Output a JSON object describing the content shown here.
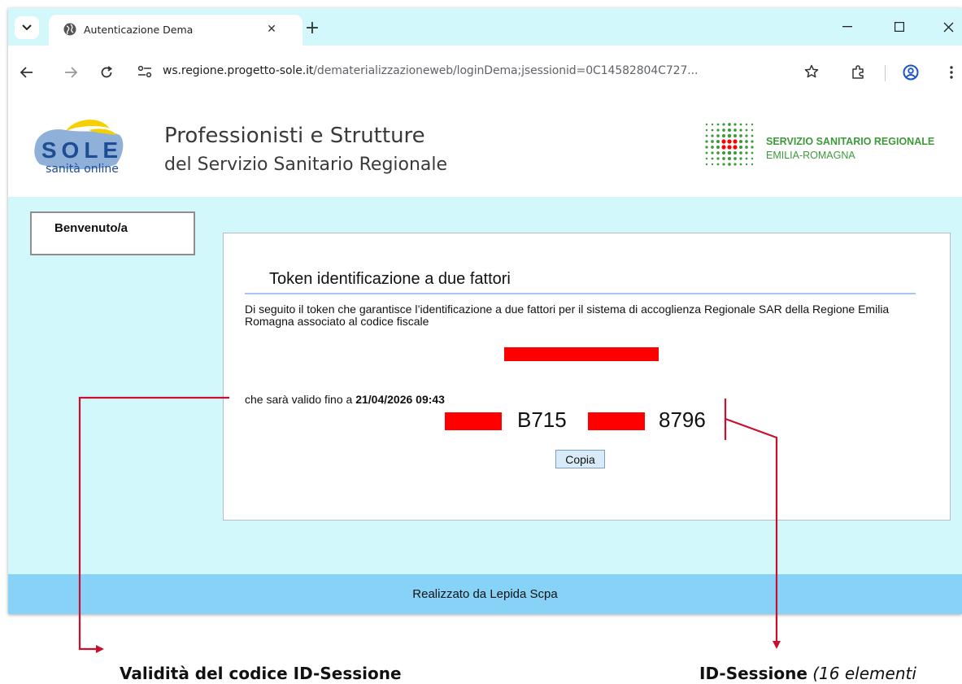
{
  "browser": {
    "tab": {
      "title": "Autenticazione Dema",
      "close_glyph": "✕",
      "favicon": "globe-icon"
    },
    "new_tab_glyph": "+",
    "window_controls": [
      "minimize-icon",
      "maximize-icon",
      "close-icon"
    ],
    "address_bar": {
      "host": "ws.regione.progetto-sole.it",
      "path": "/dematerializzazioneweb/loginDema;jsessionid=0C14582804C727..."
    },
    "toolbar_icons": [
      "back-icon",
      "forward-icon",
      "reload-icon",
      "site-info-icon",
      "star-icon",
      "extensions-icon",
      "profile-icon",
      "menu-icon"
    ]
  },
  "page": {
    "header": {
      "logo_word": "SOLE",
      "logo_tagline": "sanità online",
      "title": "Professionisti e Strutture",
      "subtitle": "del Servizio Sanitario Regionale",
      "ssr_line1": "SERVIZIO SANITARIO REGIONALE",
      "ssr_line2": "EMILIA-ROMAGNA"
    },
    "welcome": "Benvenuto/a",
    "panel": {
      "title": "Token identificazione a due fattori",
      "description": "Di seguito il token che garantisce l’identificazione a due fattori per il sistema di accoglienza Regionale SAR della Regione Emilia Romagna associato al codice fiscale",
      "valid_prefix": "che sarà valido fino a ",
      "valid_until": "21/04/2026 09:43",
      "token_visible_parts": [
        "B715",
        "8796"
      ],
      "copy_button": "Copia"
    },
    "footer": "Realizzato da Lepida Scpa"
  },
  "annotations": {
    "validity_label": "Validità del codice ID-Sessione",
    "session_label": "ID-Sessione",
    "session_note": "(16 elementi"
  },
  "colors": {
    "tab_strip": "#d3f8fc",
    "content_bg": "#d3f8fc",
    "footer_bg": "#87d3f8",
    "redaction": "#ff0000",
    "annotation_arrow": "#c8102e",
    "ssr_green": "#3c9a3a"
  }
}
